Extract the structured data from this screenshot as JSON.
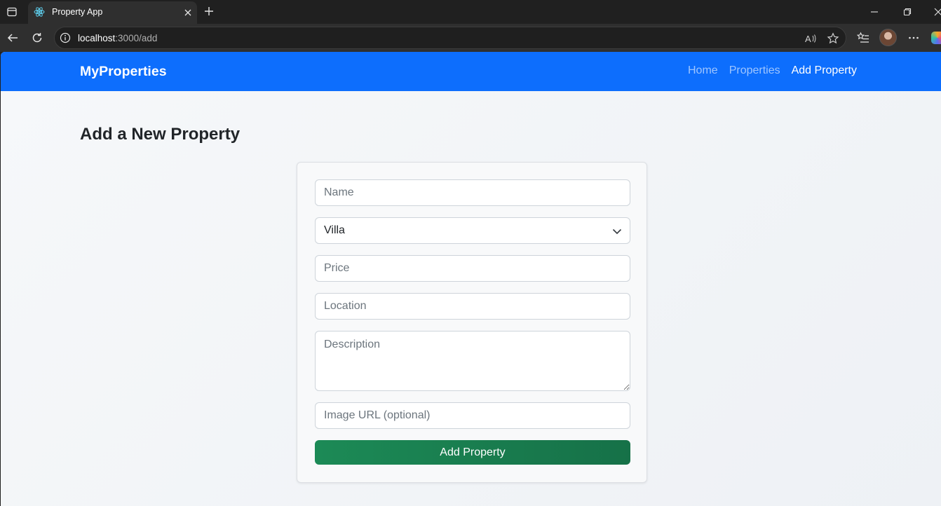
{
  "browser": {
    "tab": {
      "title": "Property App",
      "favicon": "react-icon"
    },
    "address": {
      "host": "localhost",
      "path": ":3000/add"
    }
  },
  "navbar": {
    "brand": "MyProperties",
    "links": [
      {
        "label": "Home",
        "active": false
      },
      {
        "label": "Properties",
        "active": false
      },
      {
        "label": "Add Property",
        "active": true
      }
    ],
    "color": "#0d6efd"
  },
  "page": {
    "heading": "Add a New Property"
  },
  "form": {
    "name_placeholder": "Name",
    "type_value": "Villa",
    "price_placeholder": "Price",
    "location_placeholder": "Location",
    "description_placeholder": "Description",
    "image_placeholder": "Image URL (optional)",
    "submit_label": "Add Property",
    "submit_color": "#198754"
  }
}
